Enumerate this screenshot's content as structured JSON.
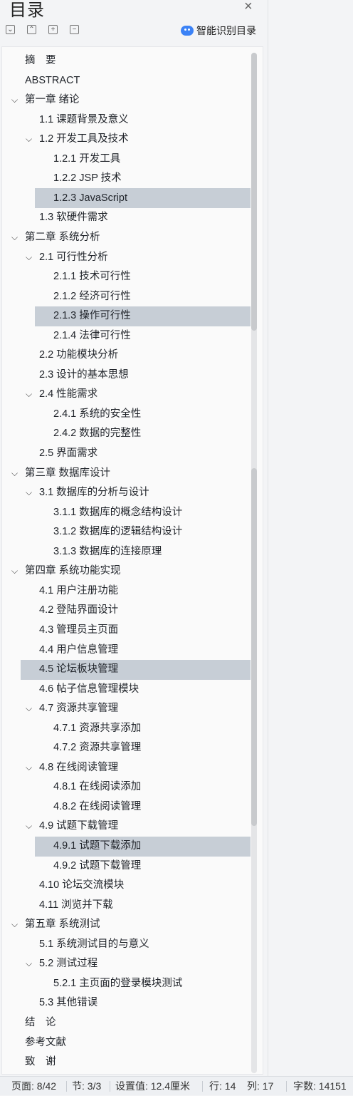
{
  "panel": {
    "title": "目录",
    "smart_label": "智能识别目录"
  },
  "toc": [
    {
      "label": "摘　要",
      "level": 0,
      "chev": false,
      "hl": false
    },
    {
      "label": "ABSTRACT",
      "level": 0,
      "chev": false,
      "hl": false
    },
    {
      "label": "第一章  绪论",
      "level": 0,
      "chev": true,
      "hl": false
    },
    {
      "label": "1.1 课题背景及意义",
      "level": 1,
      "chev": false,
      "hl": false
    },
    {
      "label": "1.2 开发工具及技术",
      "level": 1,
      "chev": true,
      "hl": false
    },
    {
      "label": "1.2.1 开发工具",
      "level": 2,
      "chev": false,
      "hl": false
    },
    {
      "label": "1.2.2 JSP 技术",
      "level": 2,
      "chev": false,
      "hl": false
    },
    {
      "label": "1.2.3 JavaScript",
      "level": 2,
      "chev": false,
      "hl": true
    },
    {
      "label": "1.3 软硬件需求",
      "level": 1,
      "chev": false,
      "hl": false
    },
    {
      "label": "第二章  系统分析",
      "level": 0,
      "chev": true,
      "hl": false
    },
    {
      "label": "2.1 可行性分析",
      "level": 1,
      "chev": true,
      "hl": false
    },
    {
      "label": "2.1.1 技术可行性",
      "level": 2,
      "chev": false,
      "hl": false
    },
    {
      "label": "2.1.2 经济可行性",
      "level": 2,
      "chev": false,
      "hl": false
    },
    {
      "label": "2.1.3 操作可行性",
      "level": 2,
      "chev": false,
      "hl": true
    },
    {
      "label": "2.1.4 法律可行性",
      "level": 2,
      "chev": false,
      "hl": false
    },
    {
      "label": "2.2 功能模块分析",
      "level": 1,
      "chev": false,
      "hl": false
    },
    {
      "label": "2.3 设计的基本思想",
      "level": 1,
      "chev": false,
      "hl": false
    },
    {
      "label": "2.4 性能需求",
      "level": 1,
      "chev": true,
      "hl": false
    },
    {
      "label": "2.4.1 系统的安全性",
      "level": 2,
      "chev": false,
      "hl": false
    },
    {
      "label": "2.4.2 数据的完整性",
      "level": 2,
      "chev": false,
      "hl": false
    },
    {
      "label": "2.5 界面需求",
      "level": 1,
      "chev": false,
      "hl": false
    },
    {
      "label": "第三章  数据库设计",
      "level": 0,
      "chev": true,
      "hl": false
    },
    {
      "label": "3.1 数据库的分析与设计",
      "level": 1,
      "chev": true,
      "hl": false
    },
    {
      "label": "3.1.1 数据库的概念结构设计",
      "level": 2,
      "chev": false,
      "hl": false
    },
    {
      "label": "3.1.2 数据库的逻辑结构设计",
      "level": 2,
      "chev": false,
      "hl": false
    },
    {
      "label": "3.1.3 数据库的连接原理",
      "level": 2,
      "chev": false,
      "hl": false
    },
    {
      "label": "第四章  系统功能实现",
      "level": 0,
      "chev": true,
      "hl": false
    },
    {
      "label": "4.1 用户注册功能",
      "level": 1,
      "chev": false,
      "hl": false
    },
    {
      "label": "4.2 登陆界面设计",
      "level": 1,
      "chev": false,
      "hl": false
    },
    {
      "label": "4.3 管理员主页面",
      "level": 1,
      "chev": false,
      "hl": false
    },
    {
      "label": "4.4 用户信息管理",
      "level": 1,
      "chev": false,
      "hl": false
    },
    {
      "label": "4.5 论坛板块管理",
      "level": 1,
      "chev": false,
      "hl": true
    },
    {
      "label": "4.6 帖子信息管理模块",
      "level": 1,
      "chev": false,
      "hl": false
    },
    {
      "label": "4.7 资源共享管理",
      "level": 1,
      "chev": true,
      "hl": false
    },
    {
      "label": "4.7.1 资源共享添加",
      "level": 2,
      "chev": false,
      "hl": false
    },
    {
      "label": "4.7.2 资源共享管理",
      "level": 2,
      "chev": false,
      "hl": false
    },
    {
      "label": "4.8 在线阅读管理",
      "level": 1,
      "chev": true,
      "hl": false
    },
    {
      "label": "4.8.1 在线阅读添加",
      "level": 2,
      "chev": false,
      "hl": false
    },
    {
      "label": "4.8.2 在线阅读管理",
      "level": 2,
      "chev": false,
      "hl": false
    },
    {
      "label": "4.9 试题下载管理",
      "level": 1,
      "chev": true,
      "hl": false
    },
    {
      "label": "4.9.1 试题下载添加",
      "level": 2,
      "chev": false,
      "hl": true
    },
    {
      "label": "4.9.2 试题下载管理",
      "level": 2,
      "chev": false,
      "hl": false
    },
    {
      "label": "4.10 论坛交流模块",
      "level": 1,
      "chev": false,
      "hl": false
    },
    {
      "label": "4.11 浏览并下载",
      "level": 1,
      "chev": false,
      "hl": false
    },
    {
      "label": "第五章  系统测试",
      "level": 0,
      "chev": true,
      "hl": false
    },
    {
      "label": "5.1 系统测试目的与意义",
      "level": 1,
      "chev": false,
      "hl": false
    },
    {
      "label": "5.2 测试过程",
      "level": 1,
      "chev": true,
      "hl": false
    },
    {
      "label": "5.2.1 主页面的登录模块测试",
      "level": 2,
      "chev": false,
      "hl": false
    },
    {
      "label": "5.3 其他错误",
      "level": 1,
      "chev": false,
      "hl": false
    },
    {
      "label": "结　论",
      "level": 0,
      "chev": false,
      "hl": false
    },
    {
      "label": "参考文献",
      "level": 0,
      "chev": false,
      "hl": false
    },
    {
      "label": "致　谢",
      "level": 0,
      "chev": false,
      "hl": false
    }
  ],
  "status": {
    "page": "页面: 8/42",
    "section": "节: 3/3",
    "setting": "设置值: 12.4厘米",
    "row": "行: 14",
    "col": "列: 17",
    "words": "字数: 14151"
  }
}
